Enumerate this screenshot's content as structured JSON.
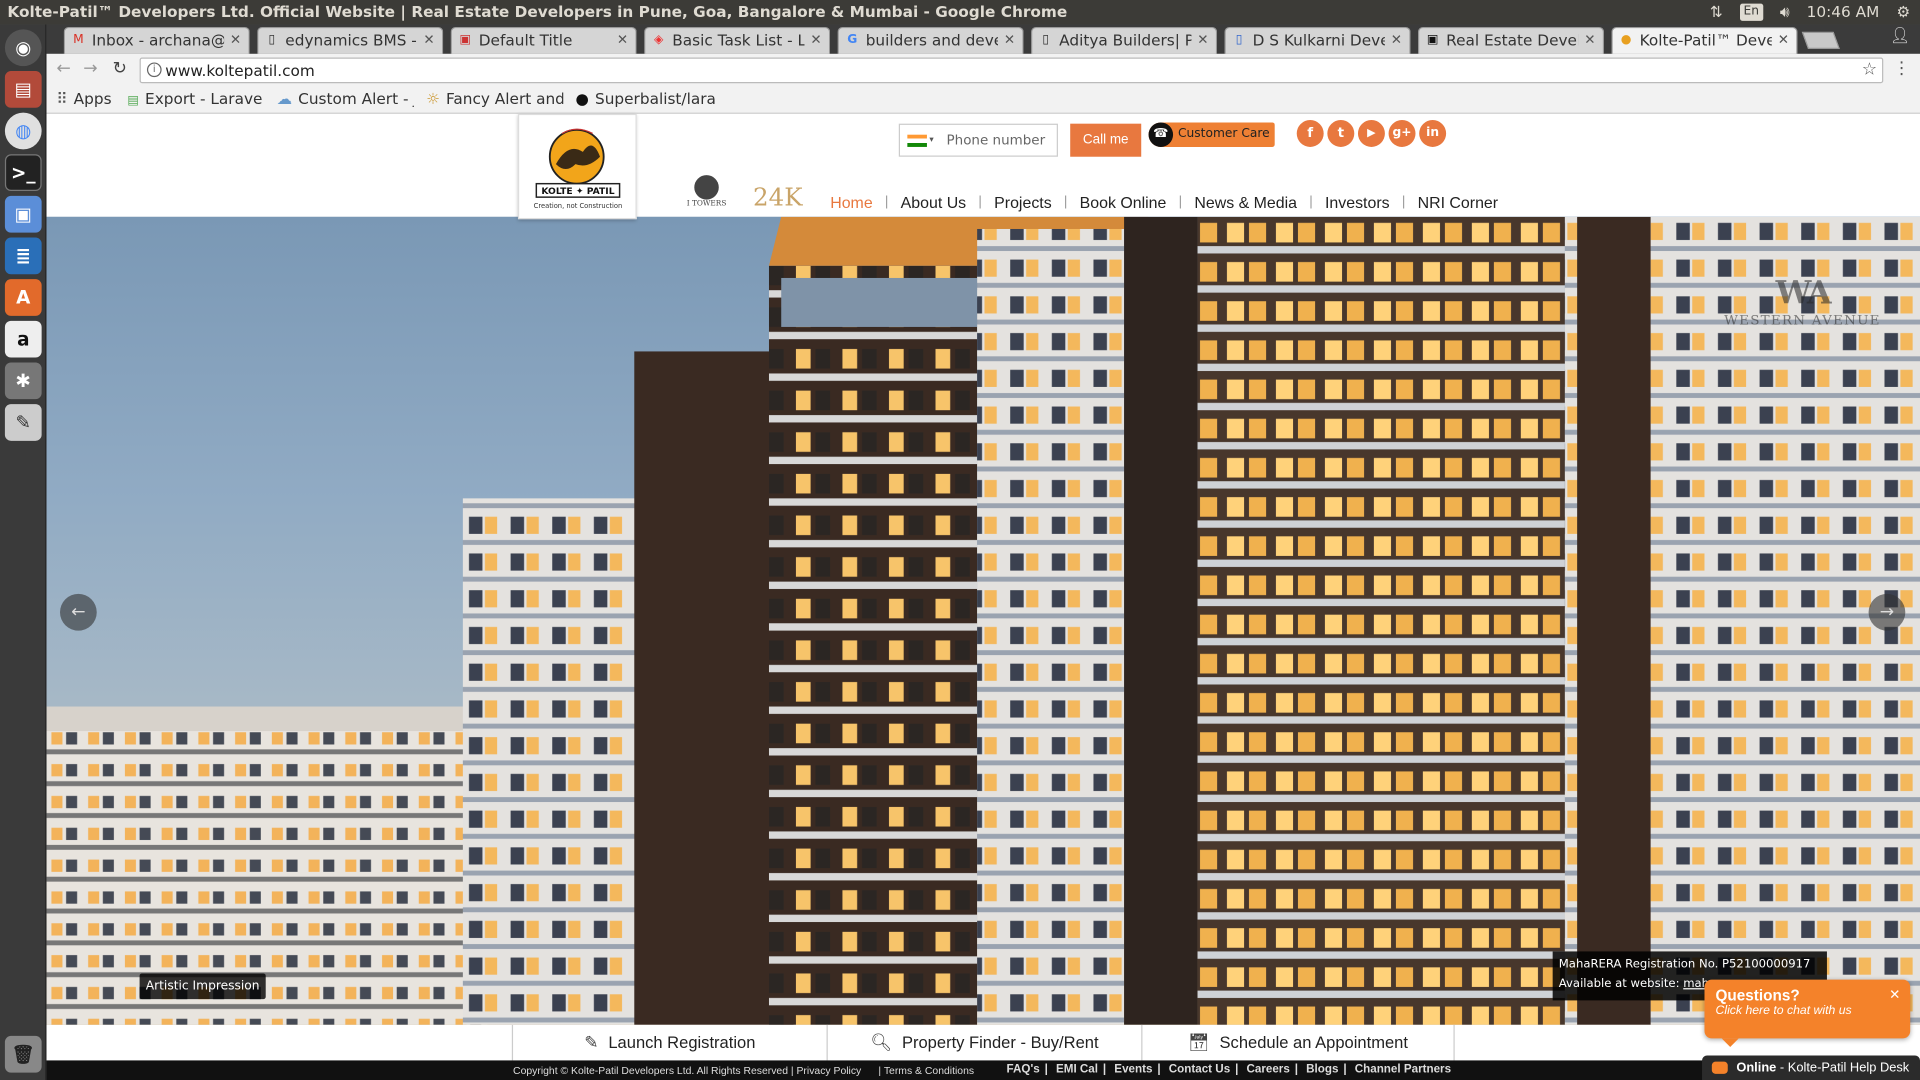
{
  "os": {
    "window_title": "Kolte-Patil™ Developers Ltd. Official Website | Real Estate Developers in Pune, Goa, Bangalore & Mumbai - Google Chrome",
    "lang": "En",
    "time": "10:46 AM"
  },
  "tabs": [
    {
      "label": "Inbox - archana@n",
      "icon": "gmail-icon"
    },
    {
      "label": "edynamics BMS - Th",
      "icon": "page-icon"
    },
    {
      "label": "Default Title",
      "icon": "page-red-icon"
    },
    {
      "label": "Basic Task List - Lar",
      "icon": "laravel-icon"
    },
    {
      "label": "builders and develo",
      "icon": "google-icon"
    },
    {
      "label": "Aditya Builders| Pr",
      "icon": "page-icon"
    },
    {
      "label": "D S Kulkarni Develo",
      "icon": "page-icon"
    },
    {
      "label": "Real Estate Develo",
      "icon": "page-icon"
    },
    {
      "label": "Kolte-Patil™ Develo",
      "icon": "kolte-icon"
    }
  ],
  "url": "www.koltepatil.com",
  "bookmarks": [
    {
      "label": "Apps"
    },
    {
      "label": "Export - Laravel"
    },
    {
      "label": "Custom Alert - JS"
    },
    {
      "label": "Fancy Alert and C"
    },
    {
      "label": "Superbalist/lara"
    }
  ],
  "site": {
    "logo_text": "KOLTE ✦ PATIL",
    "logo_tagline": "Creation, not Construction",
    "phone_placeholder": "Phone number",
    "call_label": "Call me",
    "customer_care": "Customer Care",
    "social": [
      "f",
      "t",
      "▶",
      "g+",
      "in"
    ],
    "sub_brands": {
      "i_towers": "I TOWERS",
      "k24": "24K"
    },
    "nav": [
      "Home",
      "About Us",
      "Projects",
      "Book Online",
      "News & Media",
      "Investors",
      "NRI Corner"
    ],
    "hero": {
      "watermark": "WESTERN AVENUE",
      "artistic": "Artistic Impression",
      "rera_line1": "MahaRERA Registration No. P52100000917",
      "rera_line2_prefix": "Available at website: ",
      "rera_link": "maharera"
    },
    "actions": [
      "Launch Registration",
      "Property Finder - Buy/Rent",
      "Schedule an Appointment"
    ],
    "footer": {
      "copyright": "Copyright © Kolte-Patil Developers Ltd. All Rights Reserved | Privacy Policy",
      "terms": "| Terms & Conditions",
      "links": [
        "FAQ's",
        "EMI Cal",
        "Events",
        "Contact Us",
        "Careers",
        "Blogs",
        "Channel Partners"
      ]
    },
    "chat": {
      "title": "Questions?",
      "subtitle": "Click here to chat with us"
    },
    "helpdesk": {
      "status": "Online",
      "label": " - Kolte-Patil Help Desk"
    }
  },
  "colors": {
    "accent": "#e8783f",
    "chat": "#f4822a"
  }
}
